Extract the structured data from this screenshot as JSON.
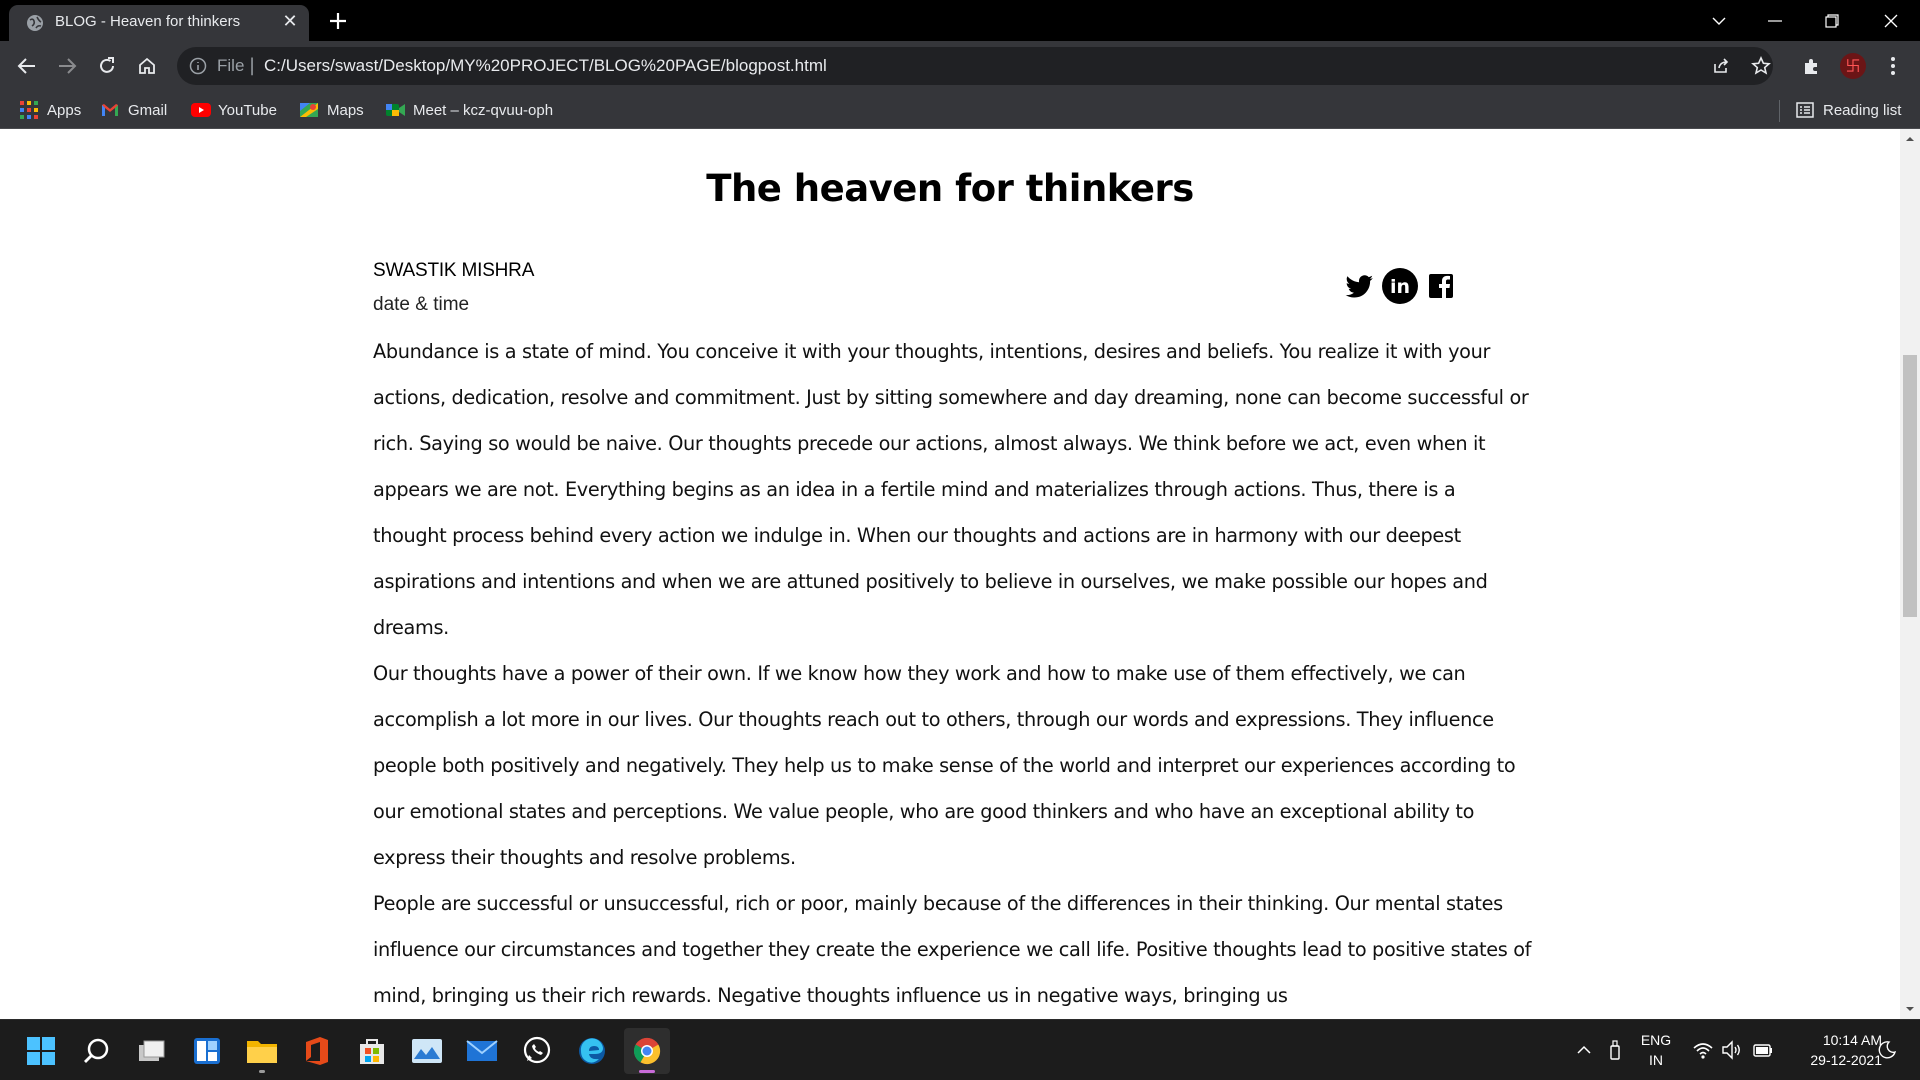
{
  "browser": {
    "tab_title": "BLOG - Heaven for thinkers",
    "url_scheme": "File",
    "url": "C:/Users/swast/Desktop/MY%20PROJECT/BLOG%20PAGE/blogpost.html",
    "bookmarks": [
      {
        "label": "Apps",
        "icon": "apps-grid-icon"
      },
      {
        "label": "Gmail",
        "icon": "gmail-icon"
      },
      {
        "label": "YouTube",
        "icon": "youtube-icon"
      },
      {
        "label": "Maps",
        "icon": "maps-icon"
      },
      {
        "label": "Meet – kcz-qvuu-oph",
        "icon": "meet-icon"
      }
    ],
    "reading_list": "Reading list",
    "profile_initial": "卐"
  },
  "page": {
    "title": "The heaven for thinkers",
    "author": "SWASTIK MISHRA",
    "datetime": "date & time",
    "social": [
      "twitter-icon",
      "linkedin-icon",
      "facebook-icon"
    ],
    "paragraphs": [
      "Abundance is a state of mind. You conceive it with your thoughts, intentions, desires and beliefs. You realize it with your actions, dedication, resolve and commitment. Just by sitting somewhere and day dreaming, none can become successful or rich. Saying so would be naive. Our thoughts precede our actions, almost always. We think before we act, even when it appears we are not. Everything begins as an idea in a fertile mind and materializes through actions. Thus, there is a thought process behind every action we indulge in. When our thoughts and actions are in harmony with our deepest aspirations and intentions and when we are attuned positively to believe in ourselves, we make possible our hopes and dreams.",
      "Our thoughts have a power of their own. If we know how they work and how to make use of them effectively, we can accomplish a lot more in our lives. Our thoughts reach out to others, through our words and expressions. They influence people both positively and negatively. They help us to make sense of the world and interpret our experiences according to our emotional states and perceptions. We value people, who are good thinkers and who have an exceptional ability to express their thoughts and resolve problems.",
      "People are successful or unsuccessful, rich or poor, mainly because of the differences in their thinking. Our mental states influence our circumstances and together they create the experience we call life. Positive thoughts lead to positive states of mind, bringing us their rich rewards. Negative thoughts influence us in negative ways, bringing us"
    ]
  },
  "taskbar": {
    "language": "ENG",
    "region": "IN",
    "time": "10:14 AM",
    "date": "29-12-2021"
  }
}
